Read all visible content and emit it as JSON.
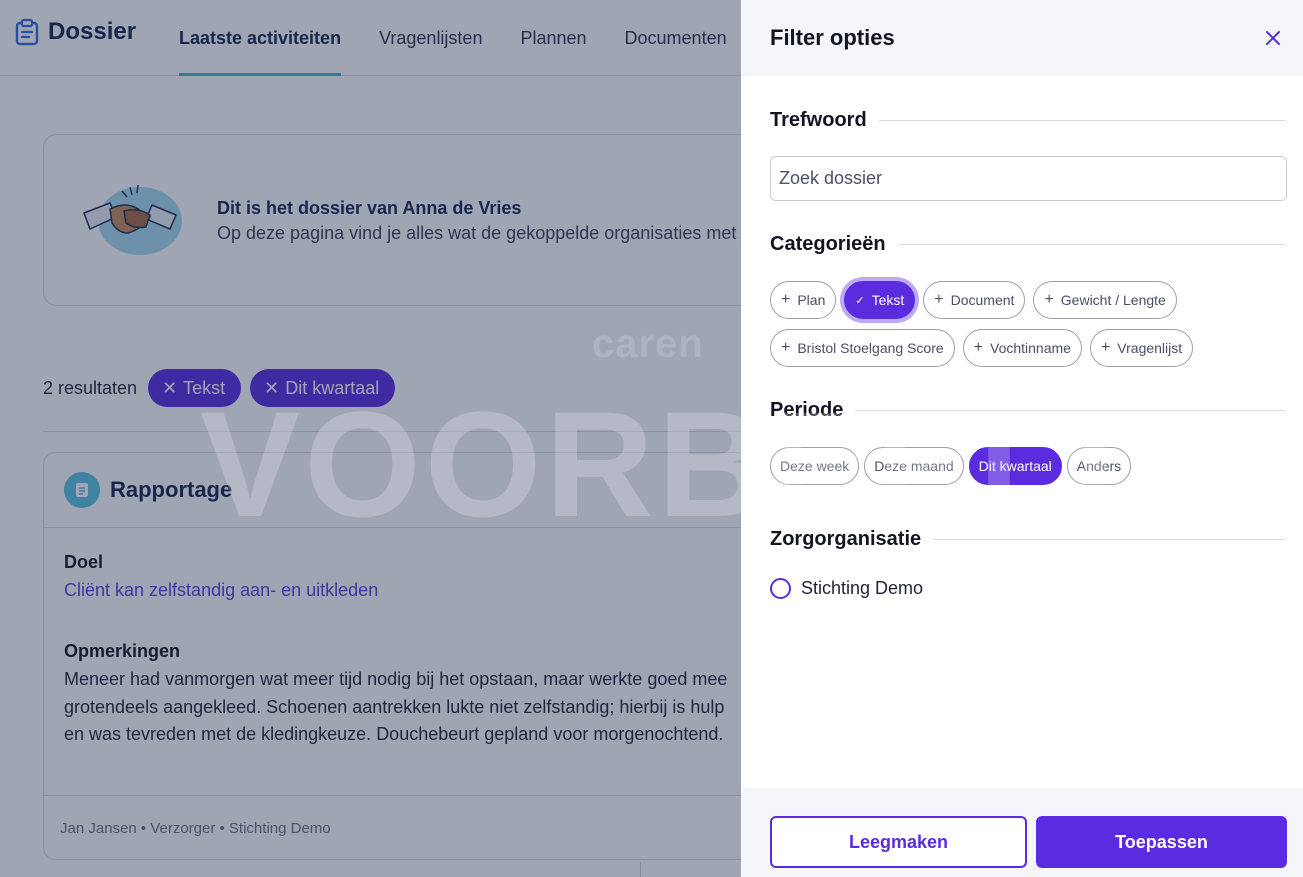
{
  "app": {
    "title": "Dossier"
  },
  "nav": {
    "tabs": [
      {
        "label": "Laatste activiteiten",
        "active": true
      },
      {
        "label": "Vragenlijsten"
      },
      {
        "label": "Plannen"
      },
      {
        "label": "Documenten"
      }
    ]
  },
  "welcome": {
    "title": "Dit is het dossier van Anna de Vries",
    "subtitle": "Op deze pagina vind je alles wat de gekoppelde organisaties met jou delen."
  },
  "results": {
    "count_label": "2 resultaten",
    "active_filters": [
      "Tekst",
      "Dit kwartaal"
    ]
  },
  "report": {
    "title": "Rapportage",
    "goal_label": "Doel",
    "goal": "Cliënt kan zelfstandig aan- en uitkleden",
    "remarks_label": "Opmerkingen",
    "remarks_lines": [
      "Meneer had vanmorgen wat meer tijd nodig bij het opstaan, maar werkte goed mee",
      "grotendeels aangekleed. Schoenen aantrekken lukte niet zelfstandig; hierbij is hulp",
      "en was tevreden met de kledingkeuze. Douchebeurt gepland voor morgenochtend."
    ],
    "footer": "Jan Jansen • Verzorger •  Stichting Demo"
  },
  "watermark": {
    "text": "VOORBEELD",
    "logo": "caren"
  },
  "filter_panel": {
    "title": "Filter opties",
    "keyword": {
      "title": "Trefwoord",
      "placeholder": "Zoek dossier",
      "value": ""
    },
    "categories": {
      "title": "Categorieën",
      "items": [
        {
          "label": "Plan",
          "selected": false
        },
        {
          "label": "Tekst",
          "selected": true
        },
        {
          "label": "Document",
          "selected": false
        },
        {
          "label": "Gewicht / Lengte",
          "selected": false
        },
        {
          "label": "Bristol Stoelgang Score",
          "selected": false
        },
        {
          "label": "Vochtinname",
          "selected": false
        },
        {
          "label": "Vragenlijst",
          "selected": false
        }
      ]
    },
    "period": {
      "title": "Periode",
      "items": [
        {
          "label": "Deze week",
          "selected": false
        },
        {
          "label": "Deze maand",
          "selected": false
        },
        {
          "label": "Dit kwartaal",
          "selected": true
        },
        {
          "label": "Anders",
          "selected": false
        }
      ]
    },
    "organisation": {
      "title": "Zorgorganisatie",
      "options": [
        {
          "label": "Stichting Demo",
          "selected": false
        }
      ]
    },
    "buttons": {
      "clear": "Leegmaken",
      "apply": "Toepassen"
    }
  },
  "colors": {
    "accent": "#5b2be0",
    "brand": "#17254d",
    "tab_underline": "#3fb8d8",
    "report_icon": "#58c3de"
  }
}
